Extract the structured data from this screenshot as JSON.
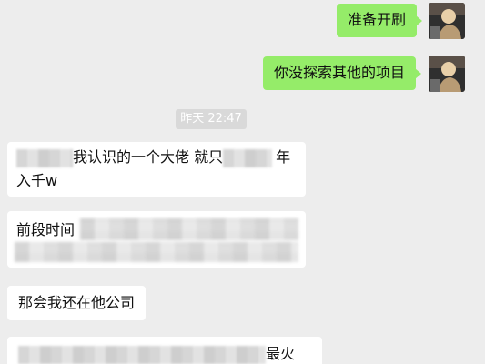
{
  "chat": {
    "messages": [
      {
        "direction": "out",
        "text": "准备开刷"
      },
      {
        "direction": "out",
        "text": "你没探索其他的项目"
      },
      {
        "direction": "in",
        "line1_a": "我认识的一个大佬  就只",
        "line1_b": "年",
        "line2": "入千w"
      },
      {
        "direction": "in",
        "text": "前段时间"
      },
      {
        "direction": "in",
        "text": "那会我还在他公司"
      },
      {
        "direction": "in",
        "text": "最火"
      }
    ],
    "timestamp": "昨天 22:47"
  },
  "colors": {
    "background": "#ededed",
    "outgoing_bubble": "#95ec69",
    "incoming_bubble": "#ffffff"
  },
  "icons": {
    "self_avatar": "user-avatar-photo"
  }
}
